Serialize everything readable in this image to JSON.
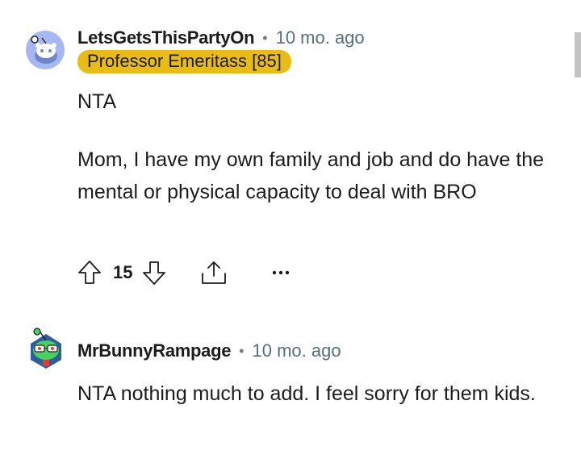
{
  "comments": [
    {
      "username": "LetsGetsThisPartyOn",
      "separator": "•",
      "time": "10 mo. ago",
      "flair": "Professor Emeritass [85]",
      "body": [
        "NTA",
        "Mom, I have my own family and job and do have the mental or physical capacity to deal with BRO"
      ],
      "votes": "15",
      "avatar_icon": "snoo-avatar-icon"
    },
    {
      "username": "MrBunnyRampage",
      "separator": "•",
      "time": "10 mo. ago",
      "body": [
        "NTA nothing much to add. I feel sorry for them kids."
      ],
      "avatar_icon": "snoo-avatar-icon"
    }
  ],
  "actions": {
    "upvote_icon": "upvote-arrow-icon",
    "downvote_icon": "downvote-arrow-icon",
    "share_icon": "share-icon",
    "more_icon": "more-options-icon"
  },
  "colors": {
    "flair_bg": "#e8bc14",
    "time": "#576f76",
    "text": "#1c1c1c"
  }
}
